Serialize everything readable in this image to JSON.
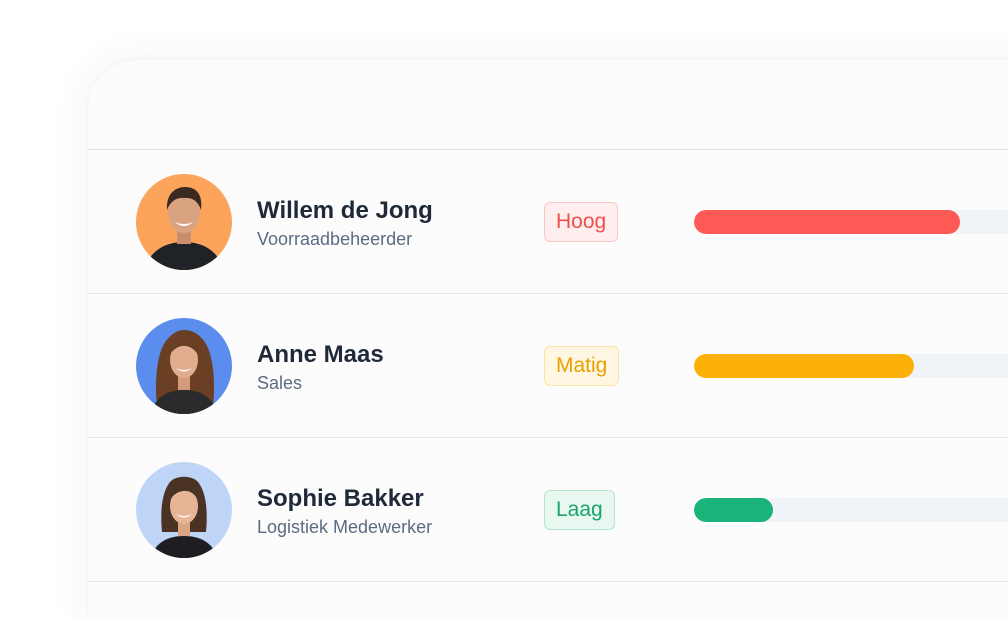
{
  "rows": [
    {
      "name": "Willem de Jong",
      "role": "Voorraadbeheerder",
      "badge": "Hoog",
      "badge_text_color": "#f0504a",
      "badge_bg_color": "#feeeee",
      "badge_border_color": "#f9c8c7",
      "bar_color": "#fd5a55",
      "bar_level": 0.74,
      "avatar_bg_color": "#fca45b"
    },
    {
      "name": "Anne Maas",
      "role": "Sales",
      "badge": "Matig",
      "badge_text_color": "#ea9f04",
      "badge_bg_color": "#fff7e2",
      "badge_border_color": "#fbe2a6",
      "bar_color": "#fdb007",
      "bar_level": 0.61,
      "avatar_bg_color": "#5b8def"
    },
    {
      "name": "Sophie Bakker",
      "role": "Logistiek Medewerker",
      "badge": "Laag",
      "badge_text_color": "#18a56a",
      "badge_bg_color": "#e8f8f0",
      "badge_border_color": "#b4e6cd",
      "bar_color": "#1ab37a",
      "bar_level": 0.22,
      "avatar_bg_color": "#bfd5f7"
    }
  ]
}
